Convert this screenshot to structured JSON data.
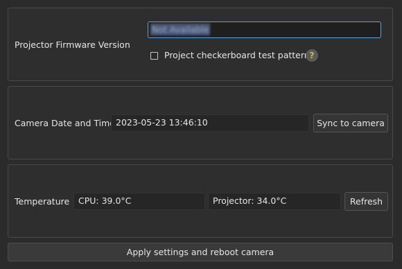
{
  "firmware": {
    "label": "Projector Firmware Version",
    "value": "Not Available",
    "checkbox_label": "Project checkerboard test pattern",
    "checkbox_checked": false,
    "help_icon": "help-icon",
    "help_glyph": "?"
  },
  "datetime": {
    "label": "Camera Date and Time",
    "value": "2023-05-23 13:46:10",
    "sync_button": "Sync to camera"
  },
  "temperature": {
    "label": "Temperature",
    "cpu": "CPU: 39.0°C",
    "projector": "Projector: 34.0°C",
    "refresh_button": "Refresh"
  },
  "apply_button": "Apply settings and reboot camera",
  "colors": {
    "background": "#2b2b2b",
    "focus_border": "#6a9fd8",
    "help_accent": "#d7b44a"
  }
}
